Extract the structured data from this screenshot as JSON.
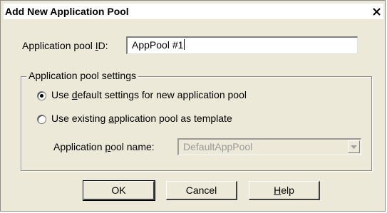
{
  "window": {
    "title": "Add New Application Pool",
    "close_icon": "close-icon"
  },
  "pool_id": {
    "label_pre": "Application pool ",
    "label_access": "I",
    "label_post": "D:",
    "value": "AppPool #1"
  },
  "settings_group": {
    "legend": "Application pool settings",
    "option_default": {
      "pre": "Use ",
      "access": "d",
      "post": "efault settings for new application pool",
      "selected": true
    },
    "option_existing": {
      "pre": "Use existing ",
      "access": "a",
      "post": "pplication pool as template",
      "selected": false
    },
    "pool_name": {
      "label_pre": "Application ",
      "label_access": "p",
      "label_post": "ool name:",
      "value": "DefaultAppPool",
      "arrow_icon": "chevron-down-icon"
    }
  },
  "buttons": {
    "ok": "OK",
    "cancel": "Cancel",
    "help_access": "H",
    "help_post": "elp"
  }
}
